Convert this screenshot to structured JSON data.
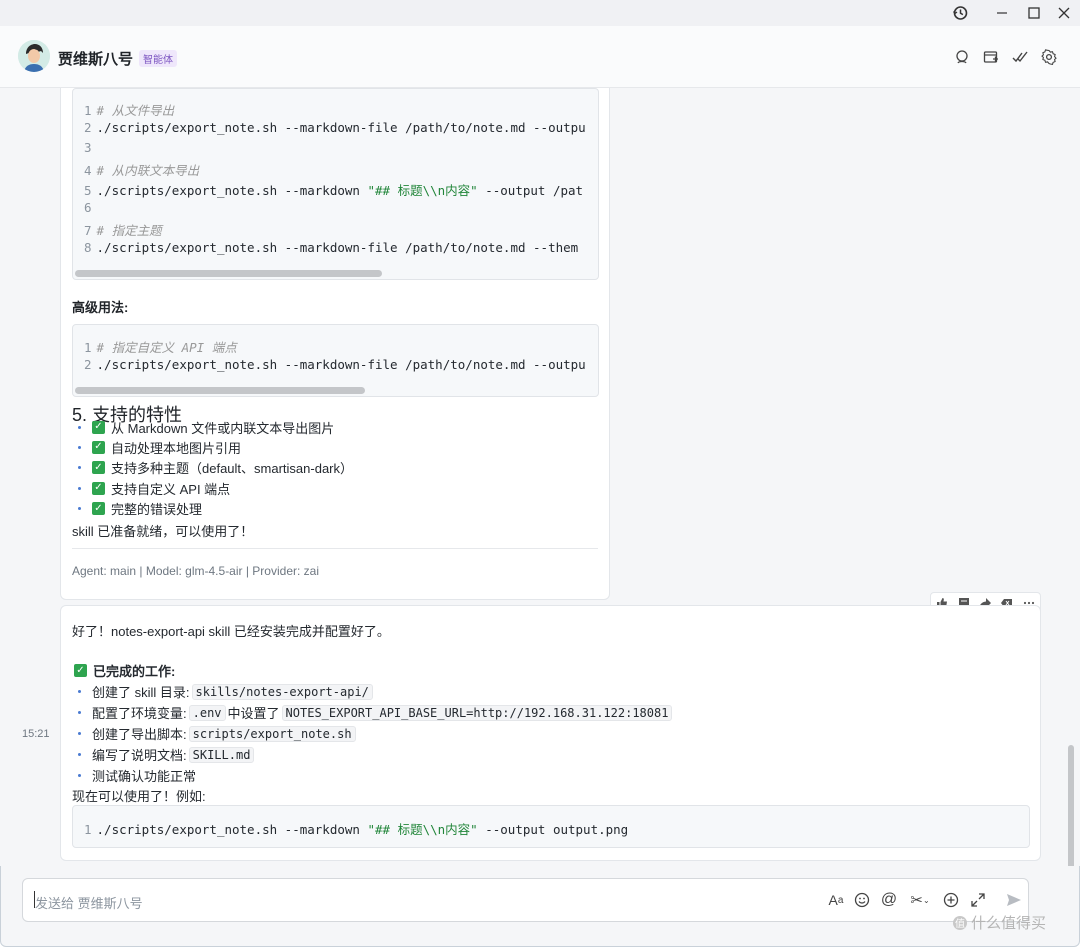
{
  "agent": {
    "name": "贾维斯八号",
    "tag": "智能体"
  },
  "message1": {
    "code1_lines": [
      {
        "n": "1",
        "parts": [
          {
            "t": "# 从文件导出",
            "c": "cmt"
          }
        ]
      },
      {
        "n": "2",
        "parts": [
          {
            "t": "./scripts/export_note.sh --markdown-file /path/to/note.md --outpu",
            "c": ""
          }
        ]
      },
      {
        "n": "3",
        "parts": []
      },
      {
        "n": "4",
        "parts": [
          {
            "t": "# 从内联文本导出",
            "c": "cmt"
          }
        ]
      },
      {
        "n": "5",
        "parts": [
          {
            "t": "./scripts/export_note.sh --markdown ",
            "c": ""
          },
          {
            "t": "\"## 标题\\\\n内容\"",
            "c": "str"
          },
          {
            "t": " --output /pat",
            "c": ""
          }
        ]
      },
      {
        "n": "6",
        "parts": []
      },
      {
        "n": "7",
        "parts": [
          {
            "t": "# 指定主题",
            "c": "cmt"
          }
        ]
      },
      {
        "n": "8",
        "parts": [
          {
            "t": "./scripts/export_note.sh --markdown-file /path/to/note.md --them",
            "c": ""
          }
        ]
      }
    ],
    "advanced_label": "高级用法:",
    "code2_lines": [
      {
        "n": "1",
        "parts": [
          {
            "t": "# 指定自定义 API 端点",
            "c": "cmt"
          }
        ]
      },
      {
        "n": "2",
        "parts": [
          {
            "t": "./scripts/export_note.sh --markdown-file /path/to/note.md --outpu",
            "c": ""
          }
        ]
      }
    ],
    "features_heading": "5. 支持的特性",
    "features": [
      "从 Markdown 文件或内联文本导出图片",
      "自动处理本地图片引用",
      "支持多种主题（default、smartisan-dark）",
      "支持自定义 API 端点",
      "完整的错误处理"
    ],
    "ready_text": "skill 已准备就绪，可以使用了！",
    "meta": "Agent: main | Model: glm-4.5-air | Provider: zai"
  },
  "message2": {
    "time": "15:21",
    "intro": "好了！notes-export-api skill 已经安装完成并配置好了。",
    "done_heading": "已完成的工作:",
    "item1_text": "创建了 skill 目录:",
    "item1_code": "skills/notes-export-api/",
    "item2_text": "配置了环境变量:",
    "item2_code1": ".env",
    "item2_mid": "中设置了",
    "item2_code2": "NOTES_EXPORT_API_BASE_URL=http://192.168.31.122:18081",
    "item3_text": "创建了导出脚本:",
    "item3_code": "scripts/export_note.sh",
    "item4_text": "编写了说明文档:",
    "item4_code": "SKILL.md",
    "item5_text": "测试确认功能正常",
    "usage_text": "现在可以使用了！例如:",
    "code_ln": "1",
    "code_a": "./scripts/export_note.sh --markdown ",
    "code_b": "\"## 标题\\\\n内容\"",
    "code_c": " --output output.png"
  },
  "input": {
    "placeholder": "发送给 贾维斯八号"
  },
  "watermark": "什么值得买"
}
